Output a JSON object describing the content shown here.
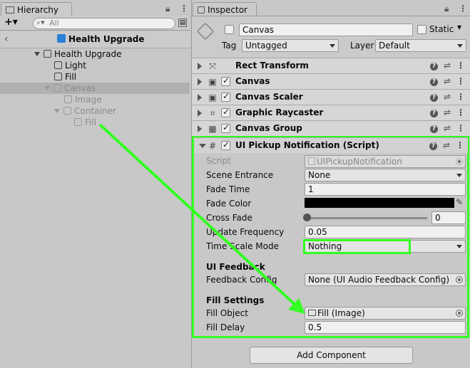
{
  "hierarchy": {
    "tab_label": "Hierarchy",
    "add_label": "+▾",
    "search_placeholder": "All",
    "scene_name": "Health Upgrade",
    "items": [
      {
        "label": "Health Upgrade"
      },
      {
        "label": "Light"
      },
      {
        "label": "Fill"
      },
      {
        "label": "Canvas"
      },
      {
        "label": "Image"
      },
      {
        "label": "Container"
      },
      {
        "label": "Fill"
      }
    ]
  },
  "inspector": {
    "tab_label": "Inspector",
    "object_name": "Canvas",
    "static_label": "Static",
    "tag_label": "Tag",
    "tag_value": "Untagged",
    "layer_label": "Layer",
    "layer_value": "Default",
    "components": [
      {
        "title": "Rect Transform",
        "icon": "rect-transform-icon"
      },
      {
        "title": "Canvas",
        "icon": "canvas-icon"
      },
      {
        "title": "Canvas Scaler",
        "icon": "canvas-scaler-icon"
      },
      {
        "title": "Graphic Raycaster",
        "icon": "graphic-raycaster-icon"
      },
      {
        "title": "Canvas Group",
        "icon": "canvas-group-icon"
      },
      {
        "title": "UI Pickup Notification (Script)",
        "icon": "script-icon"
      }
    ],
    "script_props": {
      "script_label": "Script",
      "script_value": "UIPickupNotification",
      "scene_entrance_label": "Scene Entrance",
      "scene_entrance_value": "None",
      "fade_time_label": "Fade Time",
      "fade_time_value": "1",
      "fade_color_label": "Fade Color",
      "fade_color_value": "#000000",
      "cross_fade_label": "Cross Fade",
      "cross_fade_value": "0",
      "update_frequency_label": "Update Frequency",
      "update_frequency_value": "0.05",
      "time_scale_mode_label": "Time Scale Mode",
      "time_scale_mode_value": "Nothing",
      "ui_feedback_heading": "UI Feedback",
      "feedback_config_label": "Feedback Config",
      "feedback_config_value": "None (UI Audio Feedback Config)",
      "fill_settings_heading": "Fill Settings",
      "fill_object_label": "Fill Object",
      "fill_object_value": "Fill (Image)",
      "fill_delay_label": "Fill Delay",
      "fill_delay_value": "0.5"
    },
    "add_component_label": "Add Component"
  },
  "colors": {
    "highlight": "#33ff22",
    "panel_bg": "#c8c8c8",
    "selection": "#b0b0b0"
  }
}
